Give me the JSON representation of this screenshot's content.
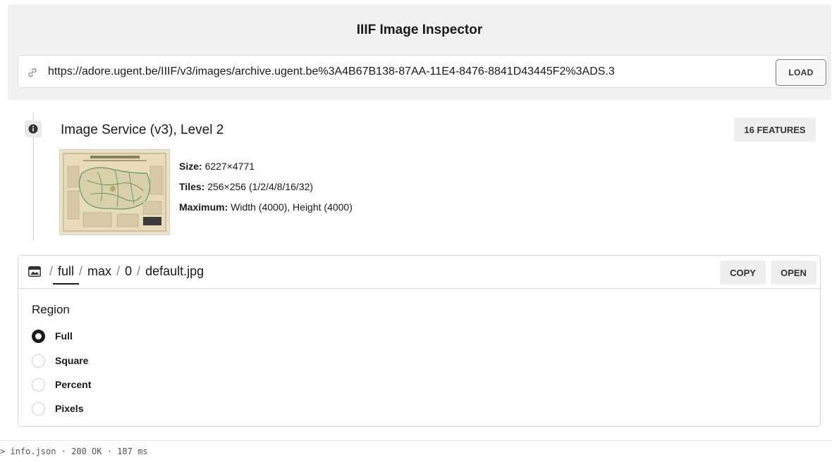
{
  "app": {
    "title": "IIIF Image Inspector"
  },
  "url_bar": {
    "value": "https://adore.ugent.be/IIIF/v3/images/archive.ugent.be%3A4B67B138-87AA-11E4-8476-8841D43445F2%3ADS.3",
    "load_label": "LOAD",
    "icon": "link-icon"
  },
  "service": {
    "title": "Image Service (v3), Level 2",
    "features_badge": "16 FEATURES",
    "icon": "info-icon",
    "size_label": "Size:",
    "size_value": "6227×4771",
    "tiles_label": "Tiles:",
    "tiles_value": "256×256 (1/2/4/8/16/32)",
    "maximum_label": "Maximum:",
    "maximum_value": "Width (4000), Height (4000)"
  },
  "request": {
    "icon": "image-icon",
    "path": {
      "sep": "/",
      "region": "full",
      "size": "max",
      "rotation": "0",
      "quality": "default.jpg"
    },
    "copy_label": "COPY",
    "open_label": "OPEN",
    "region_heading": "Region",
    "region_options": [
      "Full",
      "Square",
      "Percent",
      "Pixels"
    ],
    "region_selected": "Full"
  },
  "footer": {
    "status": "> info.json · 200 OK · 187 ms"
  },
  "colors": {
    "header_bg": "#f1f1f1",
    "text": "#1a1a1a",
    "badge_bg": "#eeeeee",
    "thumb_bg": "#ece3c8",
    "map_lines": "#5a9a6a"
  }
}
